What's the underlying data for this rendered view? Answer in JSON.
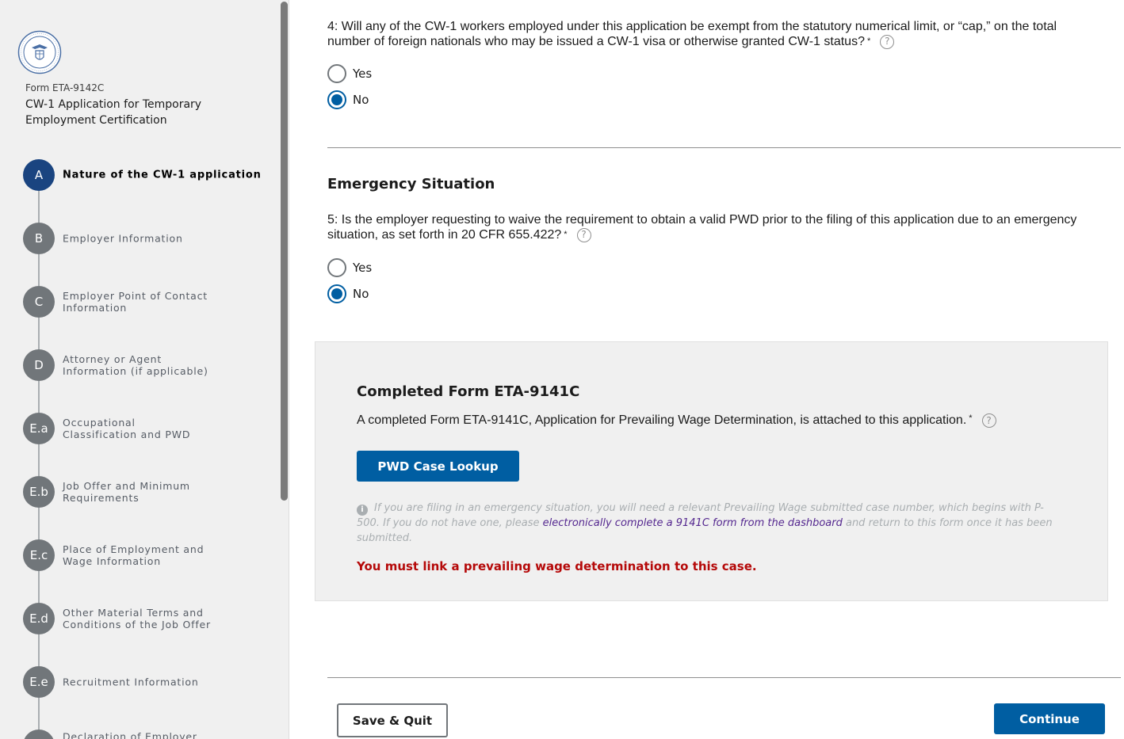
{
  "sidebar": {
    "form_number": "Form ETA-9142C",
    "form_title": "CW-1 Application for Temporary Employment Certification",
    "steps": [
      {
        "letter": "A",
        "label": "Nature of the CW-1 application",
        "active": true
      },
      {
        "letter": "B",
        "label": "Employer Information"
      },
      {
        "letter": "C",
        "label": "Employer Point of Contact Information"
      },
      {
        "letter": "D",
        "label": "Attorney or Agent Information (if applicable)"
      },
      {
        "letter": "E.a",
        "label": "Occupational Classification and PWD"
      },
      {
        "letter": "E.b",
        "label": "Job Offer and Minimum Requirements"
      },
      {
        "letter": "E.c",
        "label": "Place of Employment and Wage Information"
      },
      {
        "letter": "E.d",
        "label": "Other Material Terms and Conditions of the Job Offer"
      },
      {
        "letter": "E.e",
        "label": "Recruitment Information"
      },
      {
        "letter": "",
        "label": "Declaration of Employer"
      }
    ]
  },
  "main": {
    "q4": {
      "text": "4: Will any of the CW-1 workers employed under this application be exempt from the statutory numerical limit, or “cap,” on the total number of foreign nationals who may be issued a CW-1 visa or otherwise granted CW-1 status?",
      "required": "*",
      "options": [
        "Yes",
        "No"
      ],
      "selected": "No"
    },
    "emergency_title": "Emergency Situation",
    "q5": {
      "text": "5: Is the employer requesting to waive the requirement to obtain a valid PWD prior to the filing of this application due to an emergency situation, as set forth in 20 CFR 655.422?",
      "required": "*",
      "options": [
        "Yes",
        "No"
      ],
      "selected": "No"
    },
    "panel": {
      "title": "Completed Form ETA-9141C",
      "text": "A completed Form ETA-9141C, Application for Prevailing Wage Determination, is attached to this application.",
      "required": "*",
      "lookup_button": "PWD Case Lookup",
      "info_before": "If you are filing in an emergency situation, you will need a relevant Prevailing Wage submitted case number, which begins with P-500. If you do not have one, please ",
      "info_link": "electronically complete a 9141C form from the dashboard",
      "info_after": " and return to this form once it has been submitted.",
      "error": "You must link a prevailing wage determination to this case."
    },
    "save_quit": "Save & Quit",
    "continue": "Continue",
    "help_glyph": "?",
    "info_glyph": "i"
  },
  "colors": {
    "primary": "#005ea2",
    "active_step": "#1a4480",
    "inactive_step": "#71767a",
    "error": "#b50909",
    "link": "#54278f"
  }
}
